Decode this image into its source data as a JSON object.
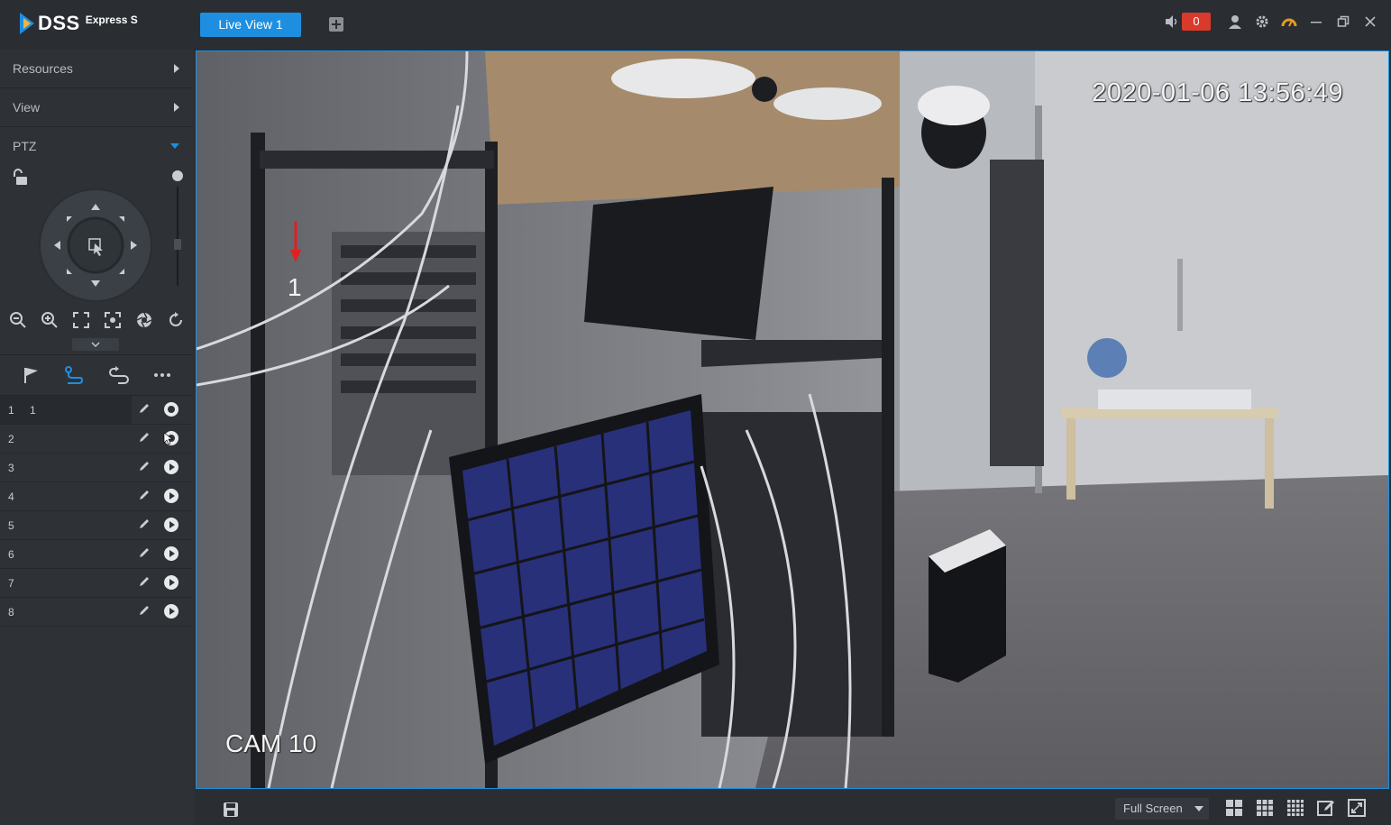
{
  "app": {
    "logo_name": "DSS",
    "logo_sub": "Express S"
  },
  "tabs": {
    "live_view": "Live View 1"
  },
  "topbar": {
    "alarm_count": "0"
  },
  "sidebar": {
    "resources": "Resources",
    "view": "View",
    "ptz": "PTZ",
    "speed_level": "4"
  },
  "presets": [
    {
      "num": "1",
      "name": "1"
    },
    {
      "num": "2",
      "name": ""
    },
    {
      "num": "3",
      "name": ""
    },
    {
      "num": "4",
      "name": ""
    },
    {
      "num": "5",
      "name": ""
    },
    {
      "num": "6",
      "name": ""
    },
    {
      "num": "7",
      "name": ""
    },
    {
      "num": "8",
      "name": ""
    }
  ],
  "video": {
    "timestamp": "2020-01-06 13:56:49",
    "camera_name": "CAM 10",
    "preset_marker": "1"
  },
  "bottombar": {
    "fullscreen_label": "Full Screen"
  },
  "colors": {
    "accent": "#1e8fe0",
    "alarm": "#d93a2b",
    "sidebar_bg": "#2e3237",
    "topbar_bg": "#2a2e33"
  }
}
